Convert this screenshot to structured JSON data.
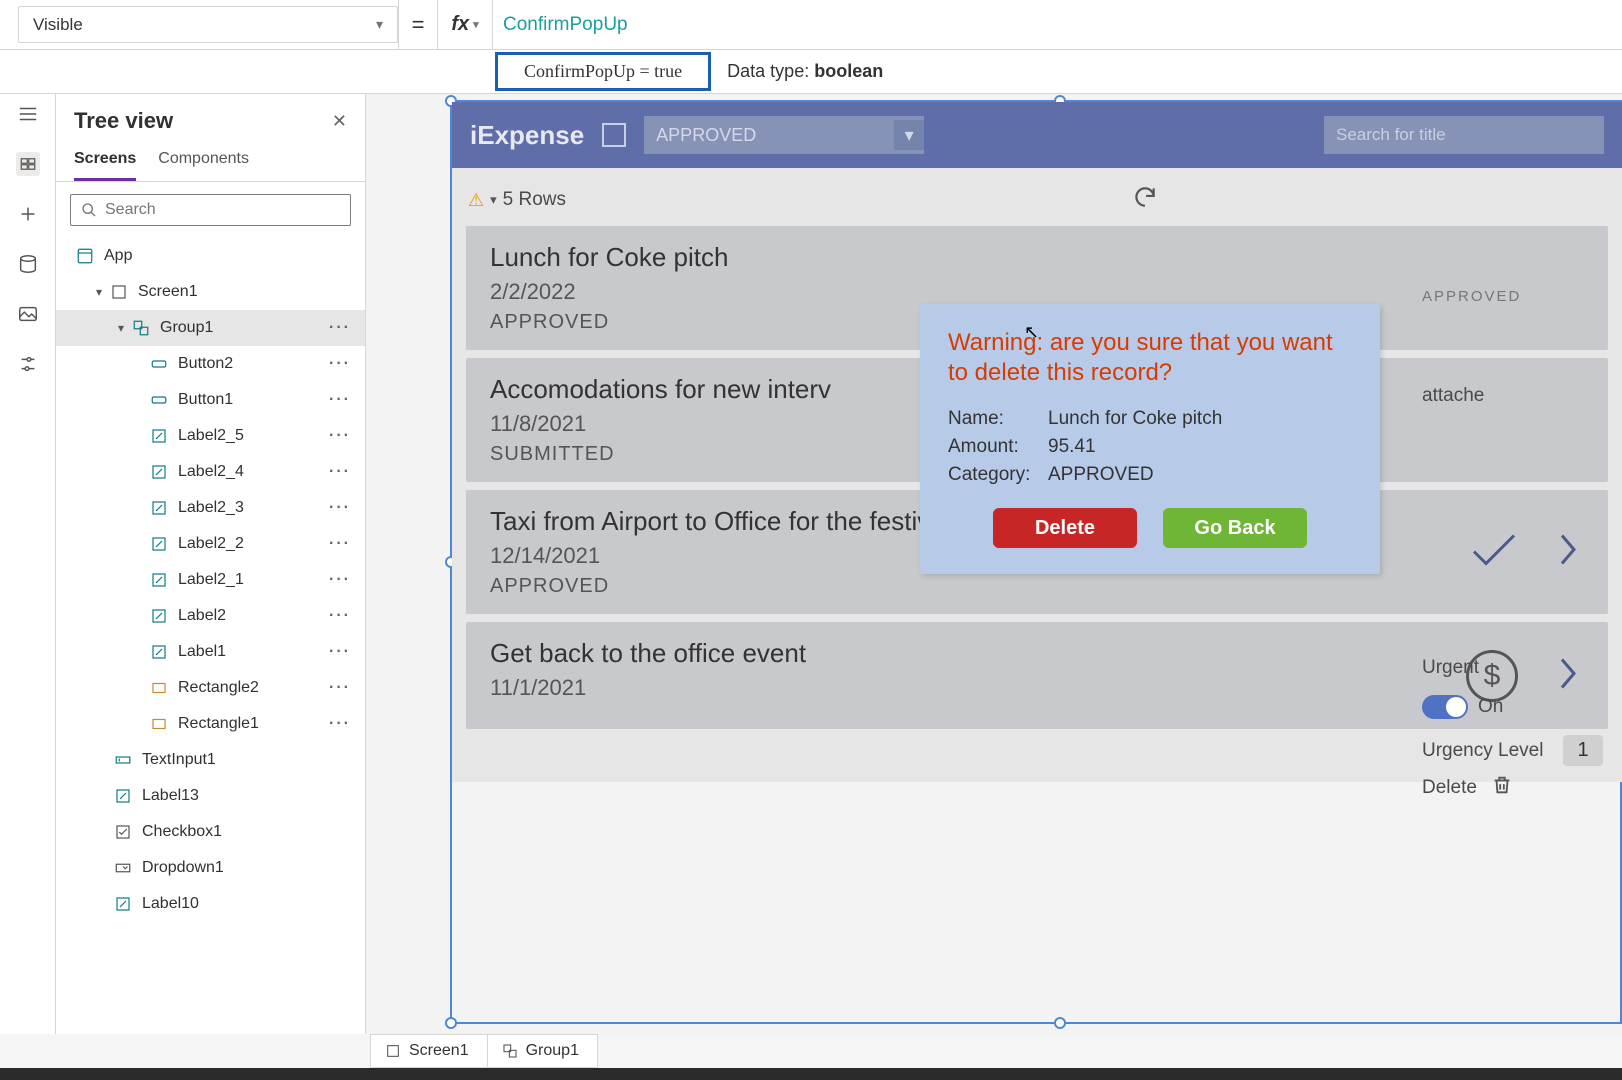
{
  "property_selector": "Visible",
  "formula": "ConfirmPopUp",
  "intellisense": "ConfirmPopUp  =  true",
  "datatype_label": "Data type: ",
  "datatype_value": "boolean",
  "tree": {
    "title": "Tree view",
    "tabs": {
      "screens": "Screens",
      "components": "Components"
    },
    "search_placeholder": "Search",
    "app": "App",
    "screen": "Screen1",
    "group": "Group1",
    "items": [
      "Button2",
      "Button1",
      "Label2_5",
      "Label2_4",
      "Label2_3",
      "Label2_2",
      "Label2_1",
      "Label2",
      "Label1",
      "Rectangle2",
      "Rectangle1"
    ],
    "after": [
      "TextInput1",
      "Label13",
      "Checkbox1",
      "Dropdown1",
      "Label10"
    ]
  },
  "app": {
    "title": "iExpense",
    "dropdown": "APPROVED",
    "search_placeholder": "Search for title",
    "rows_label": "5 Rows",
    "approved_text": "APPROVED",
    "list": [
      {
        "title": "Lunch for Coke pitch",
        "date": "2/2/2022",
        "status": "APPROVED",
        "check": false
      },
      {
        "title": "Accomodations for new interv",
        "date": "11/8/2021",
        "status": "SUBMITTED",
        "check": false
      },
      {
        "title": "Taxi from Airport to Office for the festival",
        "date": "12/14/2021",
        "status": "APPROVED",
        "check": true
      },
      {
        "title": "Get back to the office event",
        "date": "11/1/2021",
        "status": "",
        "dollar": true
      }
    ],
    "detail": {
      "attached": "attache",
      "urgent_label": "Urgent",
      "urgent_value": "On",
      "urgency_label": "Urgency Level",
      "urgency_value": "1",
      "delete_label": "Delete"
    }
  },
  "popup": {
    "warning": "Warning: are you sure that you want to delete this record?",
    "name_k": "Name:",
    "name_v": "Lunch for Coke pitch",
    "amount_k": "Amount:",
    "amount_v": "95.41",
    "cat_k": "Category:",
    "cat_v": "APPROVED",
    "delete": "Delete",
    "goback": "Go Back"
  },
  "crumbs": {
    "screen": "Screen1",
    "group": "Group1"
  }
}
